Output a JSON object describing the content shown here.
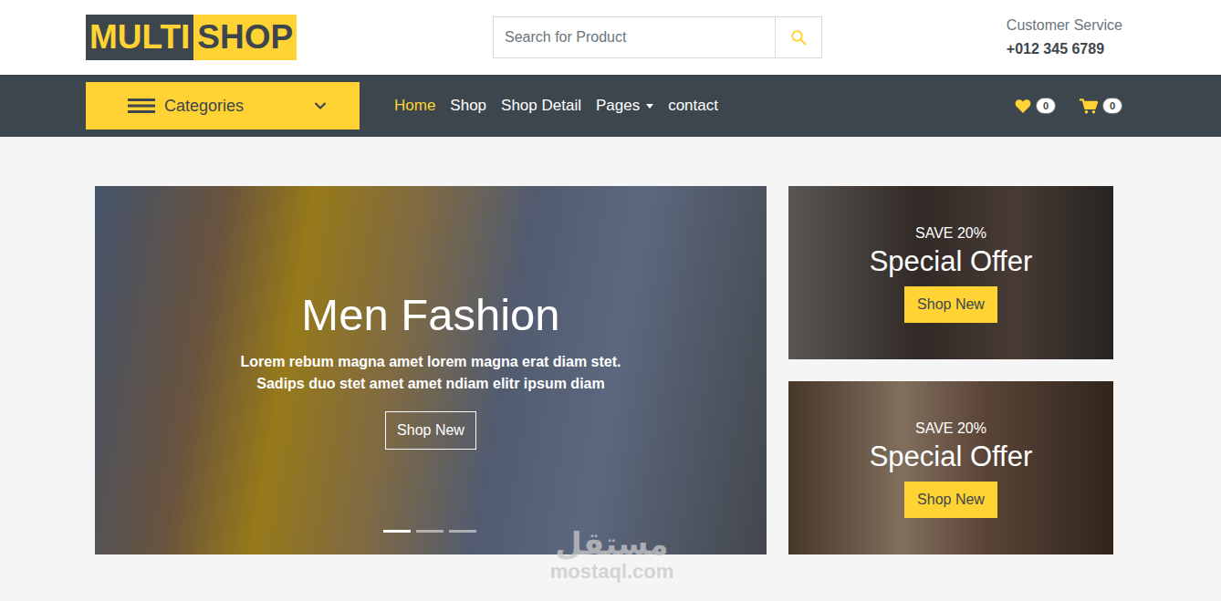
{
  "logo": {
    "part1": "MULTI",
    "part2": "SHOP"
  },
  "search": {
    "placeholder": "Search for Product"
  },
  "contact": {
    "label": "Customer Service",
    "phone": "+012 345 6789"
  },
  "categories": {
    "label": "Categories"
  },
  "nav": {
    "items": [
      {
        "label": "Home",
        "selected": true,
        "dropdown": false
      },
      {
        "label": "Shop",
        "selected": false,
        "dropdown": false
      },
      {
        "label": "Shop Detail",
        "selected": false,
        "dropdown": false
      },
      {
        "label": "Pages",
        "selected": false,
        "dropdown": true
      },
      {
        "label": "contact",
        "selected": false,
        "dropdown": false
      }
    ]
  },
  "counters": {
    "wishlist": "0",
    "cart": "0"
  },
  "carousel": {
    "title": "Men Fashion",
    "text": "Lorem rebum magna amet lorem magna erat diam stet. Sadips duo stet amet amet ndiam elitr ipsum diam",
    "button": "Shop New",
    "slides": [
      {
        "selected": true
      },
      {
        "selected": false
      },
      {
        "selected": false
      }
    ]
  },
  "offers": [
    {
      "subtitle": "SAVE 20%",
      "title": "Special Offer",
      "button": "Shop New"
    },
    {
      "subtitle": "SAVE 20%",
      "title": "Special Offer",
      "button": "Shop New"
    }
  ],
  "watermark": {
    "arabic": "مستقل",
    "latin": "mostaql.com"
  }
}
